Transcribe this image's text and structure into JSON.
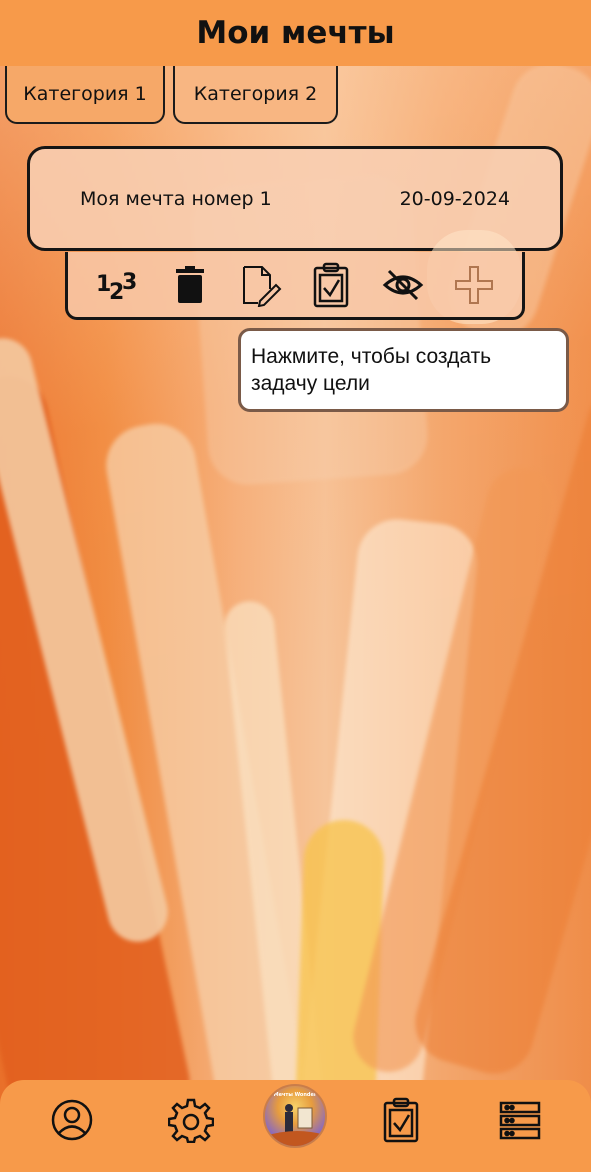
{
  "header": {
    "title": "Мои мечты"
  },
  "tabs": [
    {
      "label": "Категория 1"
    },
    {
      "label": "Категория 2"
    }
  ],
  "dream_card": {
    "title": "Моя мечта номер 1",
    "date": "20-09-2024"
  },
  "toolbar": {
    "icons": [
      "numbering-icon",
      "trash-icon",
      "edit-document-icon",
      "clipboard-check-icon",
      "eye-off-icon",
      "plus-icon"
    ]
  },
  "tooltip": {
    "text": "Нажмите, чтобы создать задачу цели"
  },
  "bottom_nav": {
    "items": [
      "profile-icon",
      "settings-icon",
      "app-logo",
      "tasks-icon",
      "list-icon"
    ],
    "logo_text": "Мечты Wonder"
  },
  "colors": {
    "accent": "#f79a4a",
    "tab_active": "#f6a868",
    "tab_inactive": "#f8b682"
  }
}
